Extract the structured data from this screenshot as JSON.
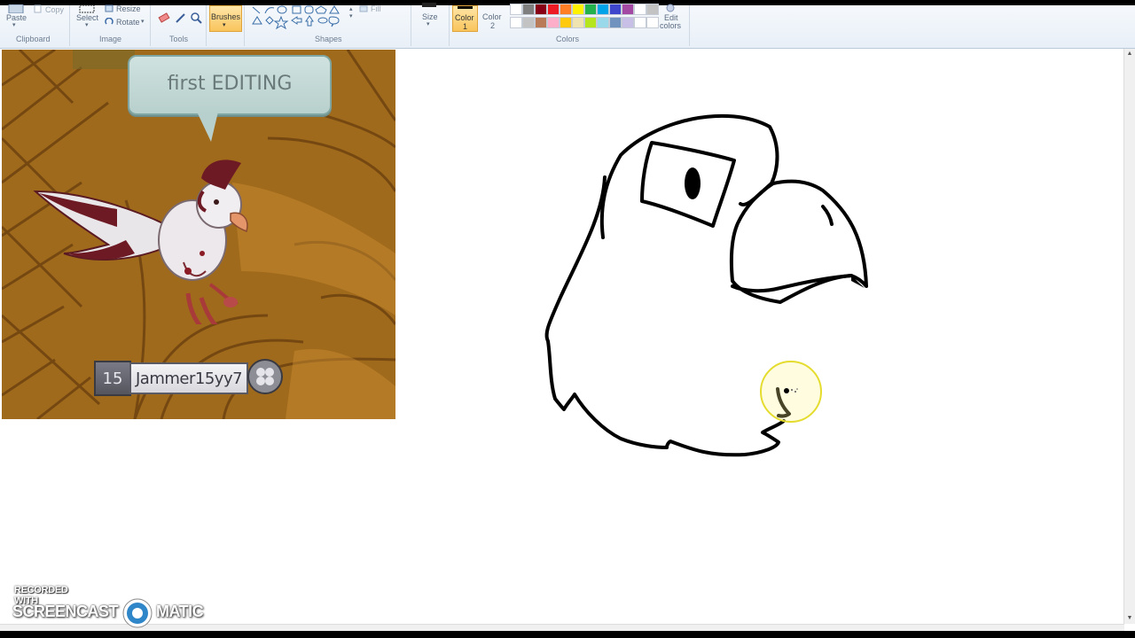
{
  "ribbon": {
    "clipboard": {
      "paste_label": "Paste",
      "copy_label": "Copy",
      "group_label": "Clipboard"
    },
    "image": {
      "select_label": "Select",
      "resize_label": "Resize",
      "rotate_label": "Rotate",
      "group_label": "Image"
    },
    "tools": {
      "group_label": "Tools"
    },
    "brushes": {
      "label": "Brushes"
    },
    "shapes": {
      "group_label": "Shapes",
      "fill_label": "Fill"
    },
    "size": {
      "label": "Size"
    },
    "colors": {
      "color1_label": "Color\n1",
      "color1_line1": "Color",
      "color1_line2": "1",
      "color2_line1": "Color",
      "color2_line2": "2",
      "edit_line1": "Edit",
      "edit_line2": "colors",
      "group_label": "Colors",
      "palette_top": [
        "#ffffff",
        "#7f7f7f",
        "#880015",
        "#ed1c24",
        "#ff7f27",
        "#fff200",
        "#22b14c",
        "#00a2e8",
        "#3f48cc",
        "#a349a4",
        "#ffffff",
        "#c3c3c3"
      ],
      "palette_bottom": [
        "#ffffff",
        "#c3c3c3",
        "#b97a57",
        "#ffaec9",
        "#ffc90e",
        "#efe4b0",
        "#b5e61d",
        "#99d9ea",
        "#7092be",
        "#c8bfe7",
        "#ffffff",
        "#ffffff"
      ]
    }
  },
  "game": {
    "speech_text": "first EDITING",
    "level": "15",
    "username": "Jammer15yy7"
  },
  "watermark": {
    "line1": "RECORDED WITH",
    "line2a": "SCREENCAST",
    "line2b": "MATIC"
  }
}
